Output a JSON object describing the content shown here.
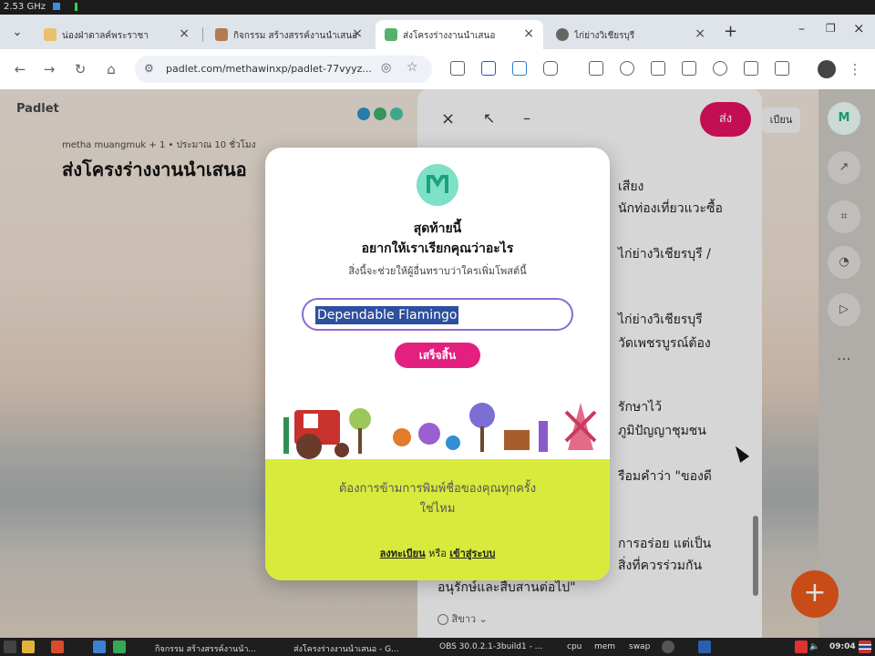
{
  "system": {
    "cpu_freq": "2.53 GHz"
  },
  "tabs": [
    {
      "label": "น่องฝ่าดาลค์พระราชา",
      "active": false
    },
    {
      "label": "กิจกรรม สร้างสรรค์งานนำเสนอ",
      "active": false
    },
    {
      "label": "ส่งโครงร่างงานนำเสนอ",
      "active": true
    },
    {
      "label": "ไก่ย่างวิเชียรบุรี",
      "active": false
    }
  ],
  "toolbar": {
    "url": "padlet.com/methawinxp/padlet-77vyyz..."
  },
  "page": {
    "brand": "Padlet",
    "meta": "metha muangmuk + 1 • ประมาณ 10 ชั่วโมง",
    "title": "ส่งโครงร่างงานนำเสนอ"
  },
  "panel": {
    "send_label": "ส่ง",
    "right_button": "เบียน",
    "privacy": "สิขาว",
    "lines": [
      "เสียง",
      "นักท่องเที่ยวแวะซื้อ",
      "ไก่ย่างวิเชียรบุรี /",
      "ไก่ย่างวิเชียรบุรี",
      "วัดเพชรบูรณ์ต้อง",
      "รักษาไว้",
      "ภูมิปัญญาชุมชน",
      "รือมคำว่า \"ของดี",
      "การอร่อย แต่เป็น",
      "สิ่งที่ควรร่วมกัน",
      "อนุรักษ์และสืบสานต่อไป\""
    ]
  },
  "modal": {
    "heading_1": "สุดท้ายนี้",
    "heading_2": "อยากให้เราเรียกคุณว่าอะไร",
    "subtitle": "สิ่งนี้จะช่วยให้ผู้อื่นทราบว่าใครเพิ่มโพสต์นี้",
    "name_value": "Dependable Flamingo",
    "done_label": "เสร็จสิ้น",
    "skip_line_1": "ต้องการข้ามการพิมพ์ชื่อของคุณทุกครั้ง",
    "skip_line_2": "ใช่ไหม",
    "signup_label": "ลงทะเบียน",
    "or_label": "หรือ",
    "login_label": "เข้าสู่ระบบ"
  },
  "taskbar": {
    "item_1": "กิจกรรม สร้างสรรค์งานนำ...",
    "item_2": "ส่งโครงร่างงานนำเสนอ - G...",
    "item_3": "OBS 30.0.2.1-3build1 - ...",
    "cpu": "cpu",
    "mem": "mem",
    "swap": "swap",
    "time": "09:04"
  }
}
